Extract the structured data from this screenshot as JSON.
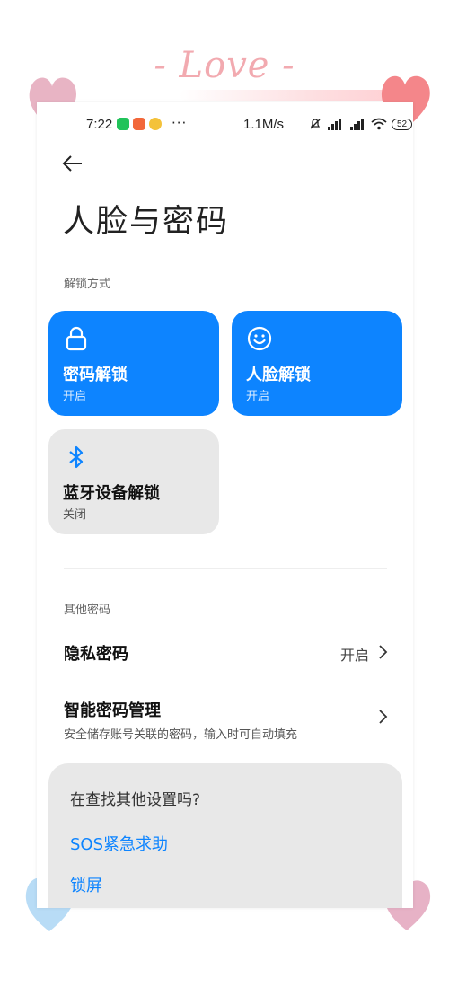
{
  "decor": {
    "love_text": "- Love -"
  },
  "status_bar": {
    "time": "7:22",
    "more": "···",
    "net_speed": "1.1M/s",
    "battery": "52"
  },
  "header": {
    "title": "人脸与密码"
  },
  "unlock_section": {
    "label": "解锁方式",
    "tiles": [
      {
        "name": "密码解锁",
        "state": "开启",
        "icon": "lock-icon"
      },
      {
        "name": "人脸解锁",
        "state": "开启",
        "icon": "smiley-icon"
      },
      {
        "name": "蓝牙设备解锁",
        "state": "关闭",
        "icon": "bluetooth-icon"
      }
    ]
  },
  "other_section": {
    "label": "其他密码",
    "items": [
      {
        "title": "隐私密码",
        "value": "开启"
      },
      {
        "title": "智能密码管理",
        "subtitle": "安全储存账号关联的密码，输入时可自动填充"
      }
    ]
  },
  "suggestions": {
    "question": "在查找其他设置吗?",
    "links": [
      "SOS紧急求助",
      "锁屏"
    ]
  },
  "colors": {
    "accent": "#0d84ff",
    "tile_gray": "#e8e8e8"
  }
}
